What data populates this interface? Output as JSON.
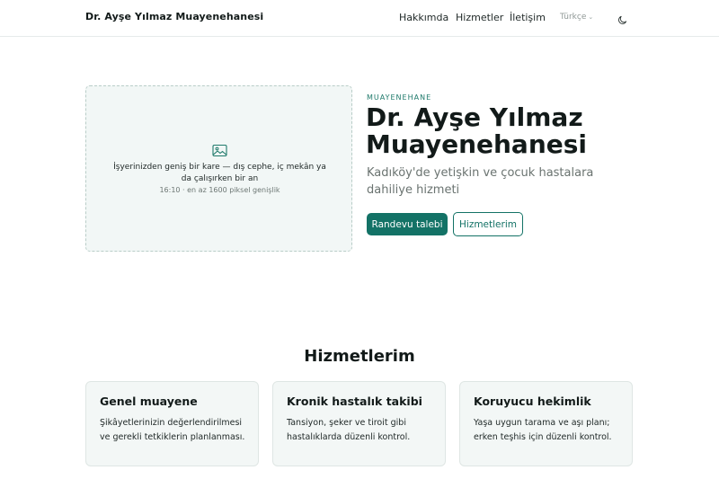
{
  "header": {
    "brand": "Dr. Ayşe Yılmaz Muayenehanesi",
    "nav": {
      "about": "Hakkımda",
      "services": "Hizmetler",
      "contact": "İletişim"
    },
    "language": "Türkçe",
    "theme_icon": "moon-icon"
  },
  "hero": {
    "image_placeholder": {
      "icon": "image-icon",
      "caption": "İşyerinizden geniş bir kare — dış cephe, iç mekân ya da çalışırken bir an",
      "spec": "16:10 · en az 1600 piksel genişlik"
    },
    "eyebrow": "MUAYENEHANE",
    "title": "Dr. Ayşe Yılmaz Muayenehanesi",
    "subtitle": "Kadıköy'de yetişkin ve çocuk hastalara dahiliye hizmeti",
    "primary_button": "Randevu talebi",
    "secondary_button": "Hizmetlerim"
  },
  "services": {
    "title": "Hizmetlerim",
    "cards": [
      {
        "title": "Genel muayene",
        "description": "Şikâyetlerinizin değerlendirilmesi ve gerekli tetkiklerin planlanması."
      },
      {
        "title": "Kronik hastalık takibi",
        "description": "Tansiyon, şeker ve tiroit gibi hastalıklarda düzenli kontrol."
      },
      {
        "title": "Koruyucu hekimlik",
        "description": "Yaşa uygun tarama ve aşı planı; erken teşhis için düzenli kontrol."
      }
    ]
  },
  "colors": {
    "accent": "#137266",
    "eyebrow": "#1f7a6b",
    "card_bg": "#f3f7f6"
  }
}
